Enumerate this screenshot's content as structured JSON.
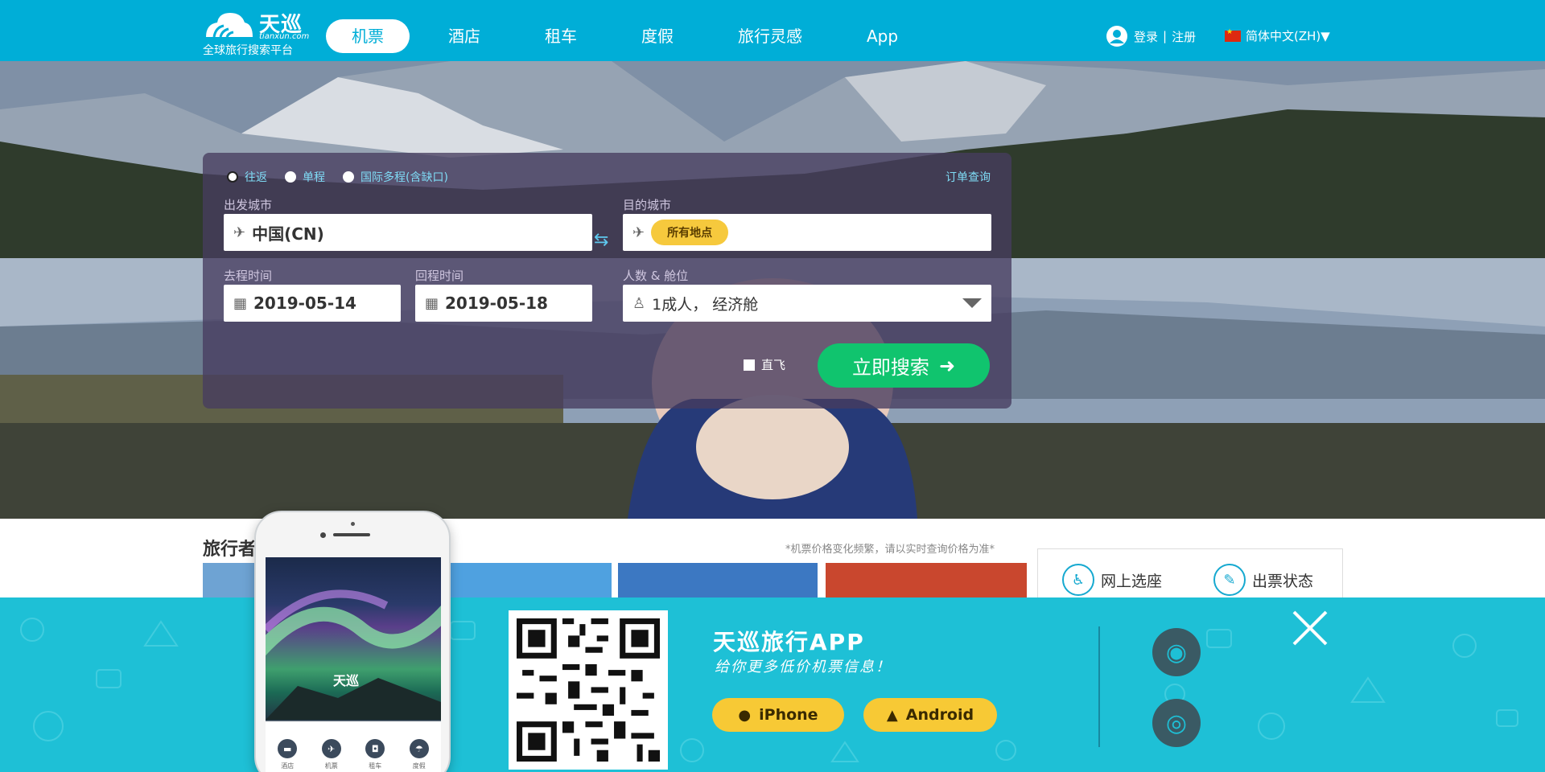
{
  "header": {
    "logo_name": "天巡",
    "logo_domain": "tianxun.com",
    "logo_slogan": "全球旅行搜索平台",
    "nav": [
      "机票",
      "酒店",
      "租车",
      "度假",
      "旅行灵感",
      "App"
    ],
    "nav_active_index": 0,
    "login": "登录",
    "separator": "|",
    "register": "注册",
    "language": "简体中文(ZH)▼",
    "user_icon": "user-avatar-icon",
    "flag_icon": "china-flag-icon"
  },
  "search": {
    "trip_types": [
      "往返",
      "单程",
      "国际多程(含缺口)"
    ],
    "selected_trip_type": "往返",
    "order_lookup": "订单查询",
    "origin_label": "出发城市",
    "origin_value": "中国(CN)",
    "destination_label": "目的城市",
    "destination_tag": "所有地点",
    "depart_label": "去程时间",
    "depart_value": "2019-05-14",
    "return_label": "回程时间",
    "return_value": "2019-05-18",
    "passengers_label": "人数 & 舱位",
    "passengers_value": "1成人， 经济舱",
    "direct_label": "直飞",
    "direct_checked": false,
    "search_button": "立即搜索",
    "icons": {
      "plane": "plane-icon",
      "swap": "swap-icon",
      "calendar": "calendar-icon",
      "person": "person-icon",
      "arrow": "arrow-right-icon"
    },
    "accent_color": "#10c46e"
  },
  "below": {
    "section_title": "旅行者",
    "price_note": "*机票价格变化频繁，请以实时查询价格为准*",
    "seat_selection": "网上选座",
    "ticket_status": "出票状态"
  },
  "app_banner": {
    "title": "天巡旅行APP",
    "subtitle": "给你更多低价机票信息！",
    "iphone_label": "iPhone",
    "android_label": "Android",
    "background_color": "#1ec0d6",
    "button_color": "#f7c935",
    "phone_logo": "天巡",
    "phone_tabs": [
      "酒店",
      "机票",
      "租车",
      "度假"
    ],
    "social_icons": [
      "wechat-icon",
      "weibo-icon"
    ],
    "close_icon": "close-icon"
  }
}
